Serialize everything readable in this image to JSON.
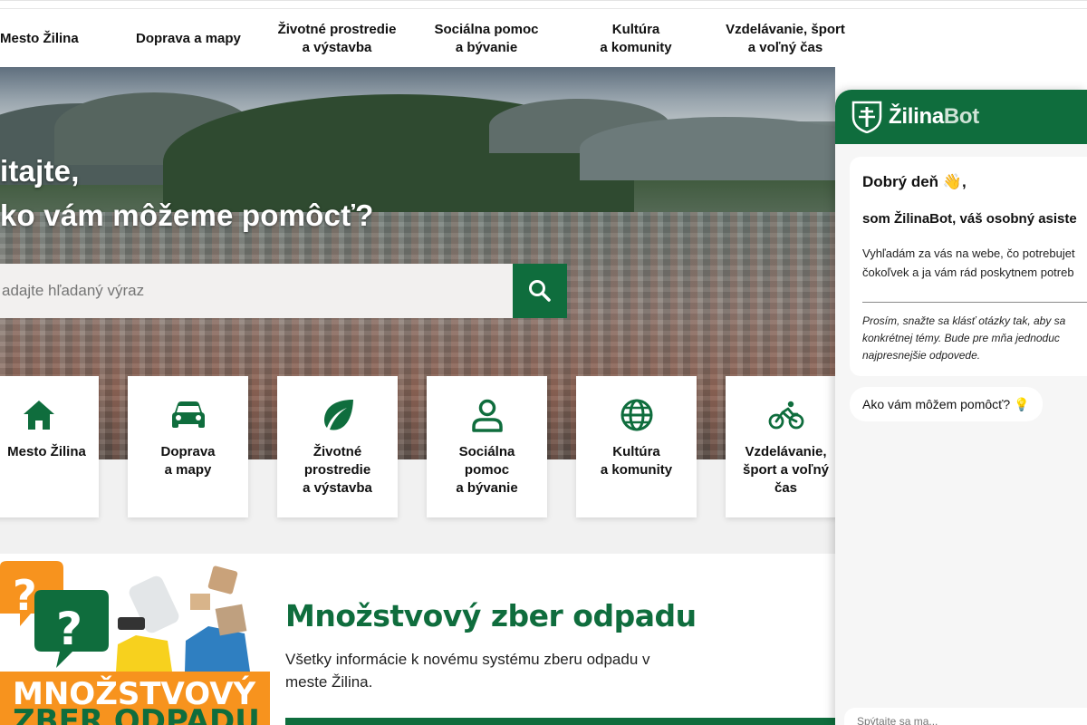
{
  "colors": {
    "brand_green": "#0f6d3d",
    "search_bg": "#f2f0ef",
    "accent_orange": "#f7931e"
  },
  "nav": {
    "items": [
      {
        "label": "Mesto Žilina"
      },
      {
        "label": "Doprava a mapy"
      },
      {
        "label": "Životné prostredie\na výstavba"
      },
      {
        "label": "Sociálna pomoc\na bývanie"
      },
      {
        "label": "Kultúra\na komunity"
      },
      {
        "label": "Vzdelávanie, šport\na voľný čas"
      }
    ]
  },
  "hero": {
    "title_line1": "itajte,",
    "title_line2": "ko vám môžeme pomôcť?",
    "search_placeholder": "adajte hľadaný výraz",
    "search_icon": "search-icon"
  },
  "cards": [
    {
      "label": "Mesto Žilina",
      "icon": "home-icon"
    },
    {
      "label": "Doprava\na mapy",
      "icon": "car-icon"
    },
    {
      "label": "Životné\nprostredie\na výstavba",
      "icon": "leaf-icon"
    },
    {
      "label": "Sociálna\npomoc\na bývanie",
      "icon": "person-icon"
    },
    {
      "label": "Kultúra\na komunity",
      "icon": "globe-icon"
    },
    {
      "label": "Vzdelávanie,\nšport a voľný\nčas",
      "icon": "bicycle-icon"
    }
  ],
  "promo": {
    "image_text": "MNOŽSTVOVÝ",
    "title": "Množstvový zber odpadu",
    "text": "Všetky informácie k novému systému zberu odpadu v meste Žilina."
  },
  "chat": {
    "brand_main": "Žilina",
    "brand_bot": "Bot",
    "greeting": "Dobrý deň 👋,",
    "subtitle": "som ŽilinaBot, váš osobný asiste",
    "description": "Vyhľadám za vás na webe, čo potrebujet\nčokoľvek a ja vám rád poskytnem potreb",
    "note": "Prosím, snažte sa klásť otázky tak, aby sa\nkonkrétnej témy. Bude pre mňa jednoduc\nnajpresnejšie odpovede.",
    "question": "Ako vám môžem pomôcť? 💡",
    "input_placeholder": "Spýtajte sa ma..."
  }
}
